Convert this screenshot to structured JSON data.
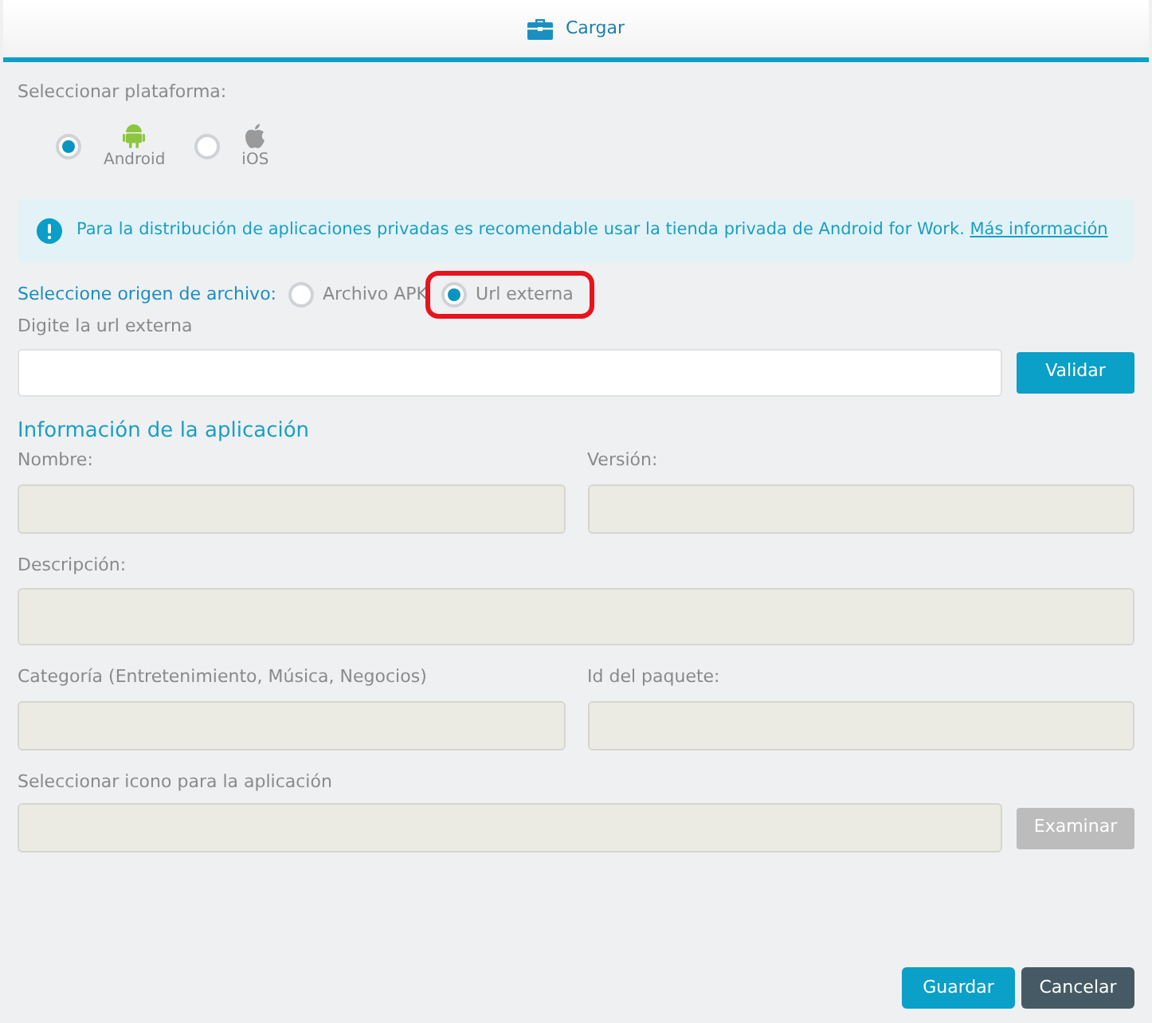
{
  "header": {
    "title": "Cargar"
  },
  "platform": {
    "label": "Seleccionar plataforma:",
    "options": [
      {
        "label": "Android",
        "kind": "android",
        "selected": true
      },
      {
        "label": "iOS",
        "kind": "apple",
        "selected": false
      }
    ]
  },
  "notice": {
    "text": "Para la distribución de aplicaciones privadas es recomendable usar la tienda privada de Android for Work.",
    "link": "Más información"
  },
  "source": {
    "label": "Seleccione origen de archivo:",
    "options": [
      {
        "label": "Archivo APK",
        "selected": false,
        "highlighted": false
      },
      {
        "label": "Url externa",
        "selected": true,
        "highlighted": true
      }
    ]
  },
  "url": {
    "label": "Digite la url externa",
    "button": "Validar"
  },
  "app_info": {
    "title": "Información de la aplicación",
    "rows": [
      [
        {
          "label": "Nombre:",
          "disabled": true
        },
        {
          "label": "Versión:",
          "disabled": true
        }
      ],
      [
        {
          "label": "Descripción:",
          "disabled": true,
          "tall": true
        }
      ],
      [
        {
          "label": "Categoría (Entretenimiento, Música, Negocios)",
          "disabled": true
        },
        {
          "label": "Id del paquete:",
          "disabled": true
        }
      ]
    ]
  },
  "icon": {
    "label": "Seleccionar icono para la aplicación",
    "button": "Examinar",
    "disabled": true
  },
  "buttons": [
    {
      "label": "Guardar",
      "kind": "primary"
    },
    {
      "label": "Cancelar",
      "kind": "secondary"
    }
  ]
}
